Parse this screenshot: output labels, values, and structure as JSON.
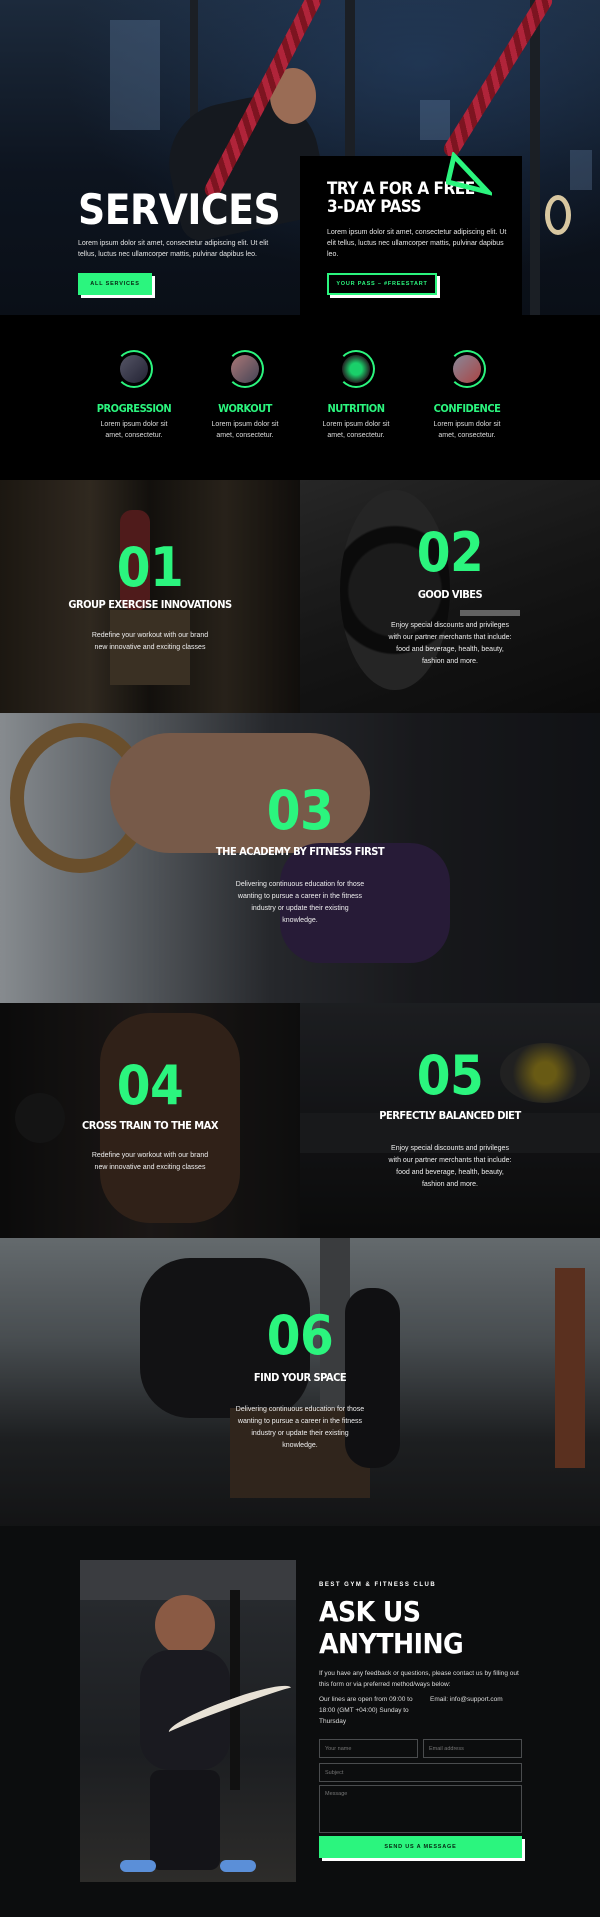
{
  "hero": {
    "title": "SERVICES",
    "text": "Lorem ipsum dolor sit amet, consectetur adipiscing elit. Ut elit tellus, luctus nec ullamcorper mattis, pulvinar dapibus leo.",
    "button_label": "ALL SERVICES"
  },
  "pass": {
    "title": "TRY A FOR A FREE 3-DAY PASS",
    "text": "Lorem ipsum dolor sit amet, consectetur adipiscing elit. Ut elit tellus, luctus nec ullamcorper mattis, pulvinar dapibus leo.",
    "button_label": "YOUR PASS – #FREESTART",
    "icon": "triangle-arrow-icon"
  },
  "features": [
    {
      "title": "PROGRESSION",
      "text": "Lorem ipsum dolor sit amet, consectetur."
    },
    {
      "title": "WORKOUT",
      "text": "Lorem ipsum dolor sit amet, consectetur."
    },
    {
      "title": "NUTRITION",
      "text": "Lorem ipsum dolor sit amet, consectetur."
    },
    {
      "title": "CONFIDENCE",
      "text": "Lorem ipsum dolor sit amet, consectetur."
    }
  ],
  "services": [
    {
      "number": "01",
      "title": "GROUP EXERCISE INNOVATIONS",
      "text": "Redefine your workout with our brand new innovative and exciting classes"
    },
    {
      "number": "02",
      "title": "GOOD VIBES",
      "text": "Enjoy special discounts and privileges with our partner merchants that include: food and beverage, health, beauty, fashion and more."
    },
    {
      "number": "03",
      "title": "THE ACADEMY BY FITNESS FIRST",
      "text": "Delivering continuous education for those wanting to pursue a career in the fitness industry or update their existing knowledge."
    },
    {
      "number": "04",
      "title": "CROSS TRAIN TO THE MAX",
      "text": "Redefine your workout with our brand new innovative and exciting classes"
    },
    {
      "number": "05",
      "title": "PERFECTLY BALANCED DIET",
      "text": "Enjoy special discounts and privileges with our partner merchants that include: food and beverage, health, beauty, fashion and more."
    },
    {
      "number": "06",
      "title": "FIND YOUR SPACE",
      "text": "Delivering continuous education for those wanting to pursue a career in the fitness industry or update their existing knowledge."
    }
  ],
  "contact": {
    "kicker": "BEST GYM & FITNESS CLUB",
    "title": "ASK US ANYTHING",
    "text": "If you have any feedback or questions, please contact us by filling out this form or via preferred method/ways below:",
    "hours": "Our lines are open from 09:00 to 18:00 (GMT +04:00) Sunday to Thursday",
    "email": "Email: info@support.com",
    "name_placeholder": "Your name",
    "email_placeholder": "Email address",
    "subject_placeholder": "Subject",
    "message_placeholder": "Message",
    "send_label": "SEND US A MESSAGE"
  },
  "colors": {
    "accent": "#2bf57e",
    "background": "#000000"
  }
}
